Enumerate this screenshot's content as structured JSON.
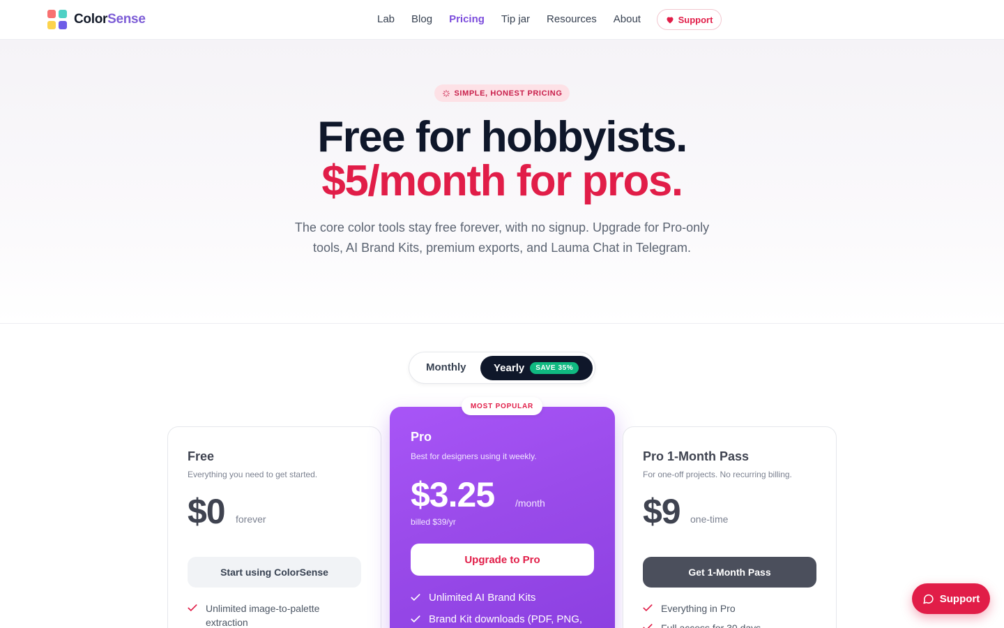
{
  "brand": {
    "name_part1": "Color",
    "name_part2": "Sense"
  },
  "nav": {
    "links": [
      "Lab",
      "Blog",
      "Pricing",
      "Tip jar",
      "Resources",
      "About"
    ],
    "active": "Pricing",
    "support_label": "Support"
  },
  "hero": {
    "badge": "SIMPLE, HONEST PRICING",
    "headline_line1": "Free for hobbyists.",
    "headline_line2": "$5/month for pros.",
    "subtitle": "The core color tools stay free forever, with no signup. Upgrade for Pro-only tools, AI Brand Kits, premium exports, and Lauma Chat in Telegram."
  },
  "billing_toggle": {
    "monthly_label": "Monthly",
    "yearly_label": "Yearly",
    "yearly_badge": "SAVE 35%",
    "selected": "Yearly"
  },
  "plans": {
    "free": {
      "name": "Free",
      "description": "Everything you need to get started.",
      "price": "$0",
      "unit": "forever",
      "cta": "Start using ColorSense",
      "features": [
        "Unlimited image-to-palette extraction"
      ]
    },
    "pro": {
      "badge": "MOST POPULAR",
      "name": "Pro",
      "description": "Best for designers using it weekly.",
      "price": "$3.25",
      "unit": "/month",
      "billed": "billed $39/yr",
      "cta": "Upgrade to Pro",
      "features": [
        "Unlimited AI Brand Kits",
        "Brand Kit downloads (PDF, PNG,"
      ]
    },
    "pass": {
      "name": "Pro 1-Month Pass",
      "description": "For one-off projects. No recurring billing.",
      "price": "$9",
      "unit": "one-time",
      "cta": "Get 1-Month Pass",
      "features": [
        "Everything in Pro",
        "Full access for 30 days"
      ]
    }
  },
  "floating_support": {
    "label": "Support"
  },
  "colors": {
    "accent_pink": "#e11d48",
    "accent_purple": "#9a4bea",
    "nav_active": "#7c4ddc",
    "dark": "#0f172a",
    "save_green": "#10b981"
  }
}
